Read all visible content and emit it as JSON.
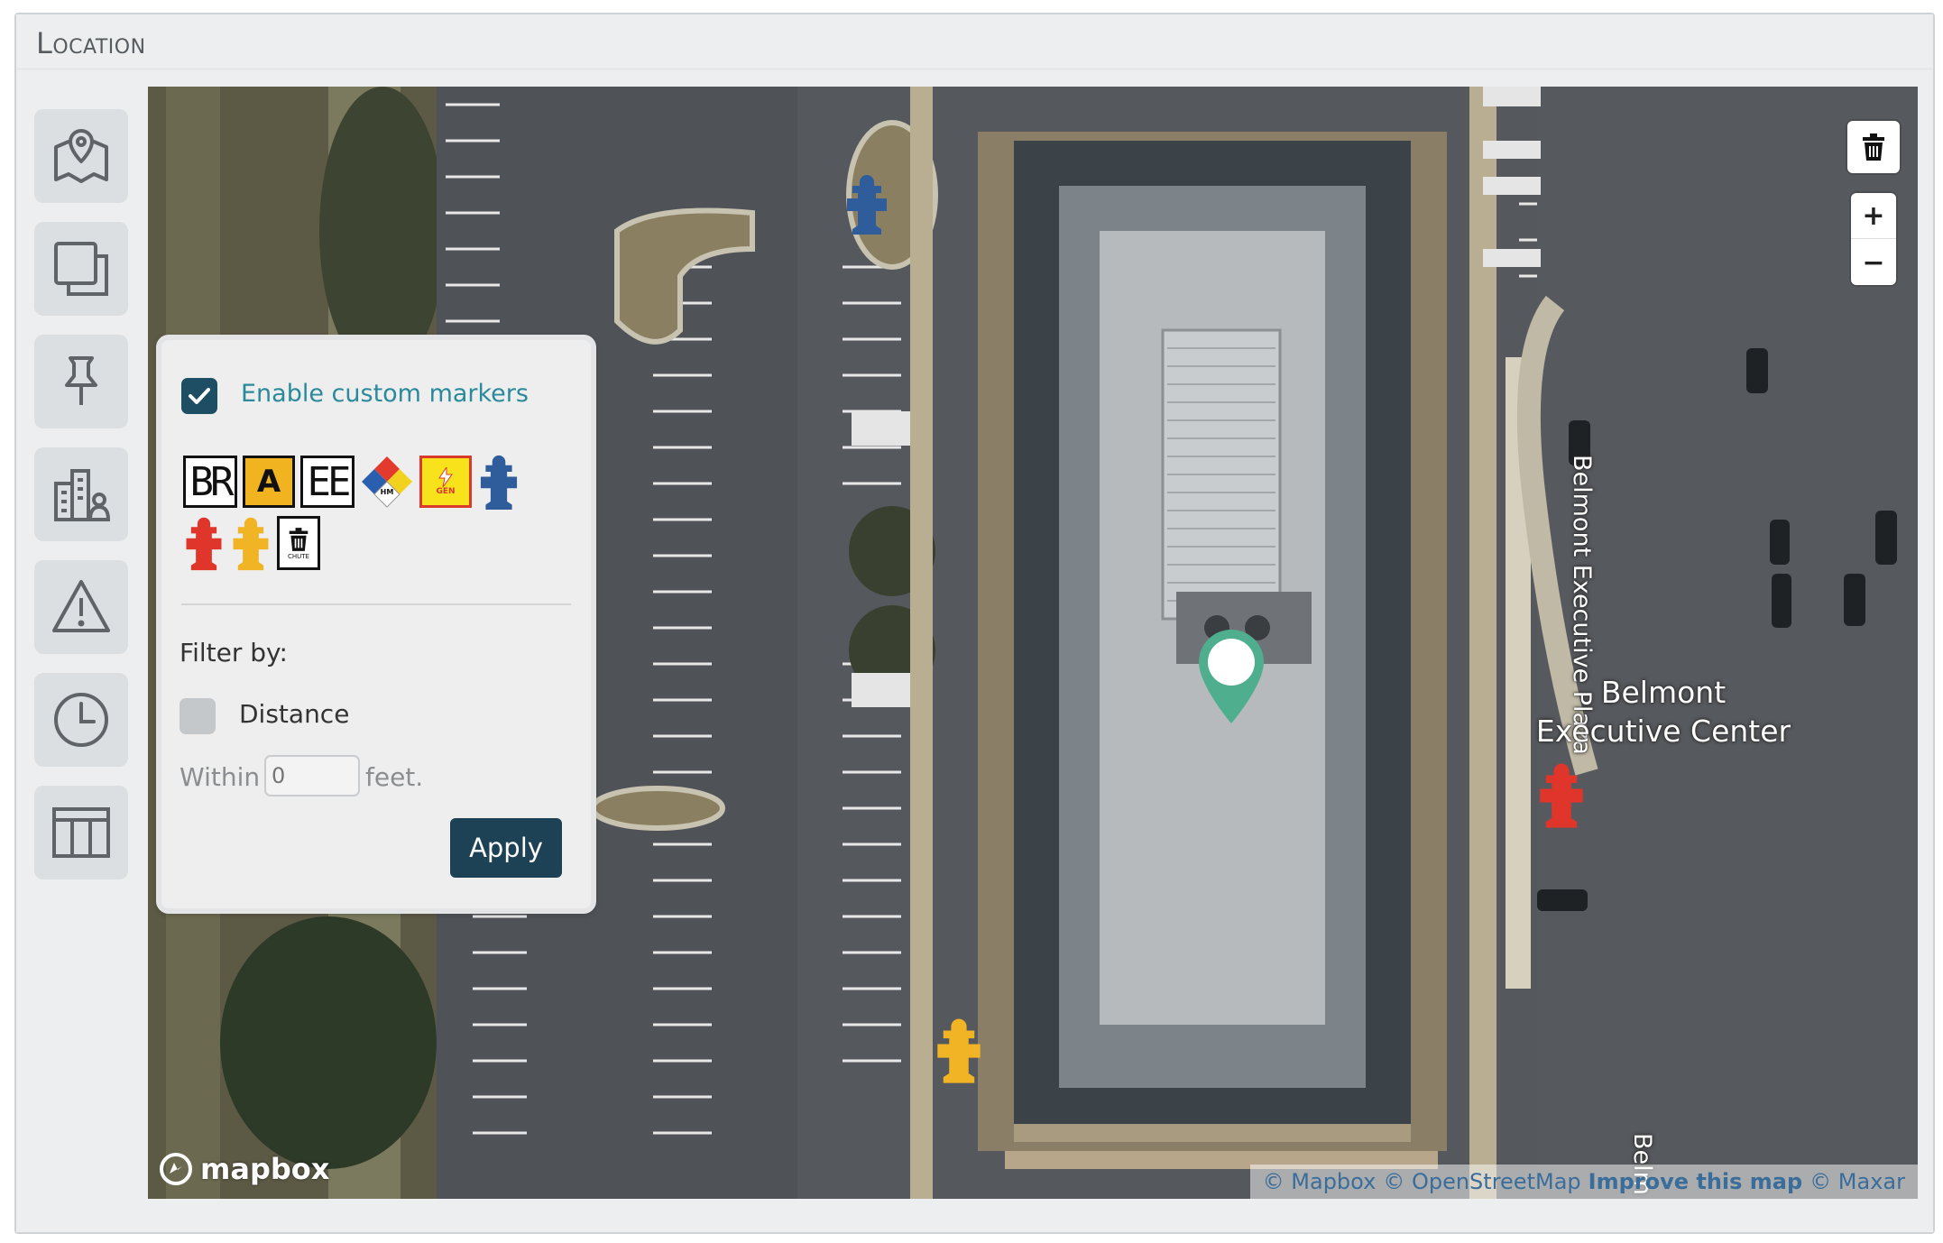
{
  "panel": {
    "title": "Location"
  },
  "sidebar": {
    "items": [
      {
        "name": "map-view",
        "icon": "map-pin-icon"
      },
      {
        "name": "layers",
        "icon": "layers-icon"
      },
      {
        "name": "pin",
        "icon": "pushpin-icon"
      },
      {
        "name": "buildings",
        "icon": "building-person-icon"
      },
      {
        "name": "hazards",
        "icon": "warning-icon"
      },
      {
        "name": "history",
        "icon": "clock-icon"
      },
      {
        "name": "table",
        "icon": "table-icon"
      }
    ]
  },
  "popup": {
    "enable_custom_markers_label": "Enable custom markers",
    "enable_custom_markers_checked": true,
    "markers": [
      {
        "label": "BR",
        "icon": "br-marker"
      },
      {
        "label": "A",
        "icon": "a-marker"
      },
      {
        "label": "EE",
        "icon": "ee-marker"
      },
      {
        "label": "HM",
        "icon": "hazmat-diamond-icon"
      },
      {
        "label": "GEN",
        "icon": "generator-icon"
      },
      {
        "label": "",
        "icon": "blue-hydrant-icon"
      },
      {
        "label": "",
        "icon": "red-hydrant-icon"
      },
      {
        "label": "",
        "icon": "yellow-hydrant-icon"
      },
      {
        "label": "CHUTE",
        "icon": "trash-chute-icon"
      }
    ],
    "filter_label": "Filter by:",
    "distance_label": "Distance",
    "distance_checked": false,
    "within_label": "Within",
    "within_placeholder": "0",
    "feet_label": "feet.",
    "apply_label": "Apply"
  },
  "map": {
    "street_label": "Belmont Executive Plaza",
    "street_label_2": "Belm",
    "poi_label_line1": "Belmont",
    "poi_label_line2": "Executive Center",
    "zoom_in_label": "+",
    "zoom_out_label": "−",
    "logo_text": "mapbox",
    "attribution": {
      "mapbox": "© Mapbox",
      "osm": "© OpenStreetMap",
      "improve": "Improve this map",
      "maxar": "© Maxar"
    },
    "colors": {
      "selected_pin": "#4fae8e",
      "hydrant_blue": "#2f5d9b",
      "hydrant_red": "#e0352b",
      "hydrant_yellow": "#f0b425"
    }
  }
}
